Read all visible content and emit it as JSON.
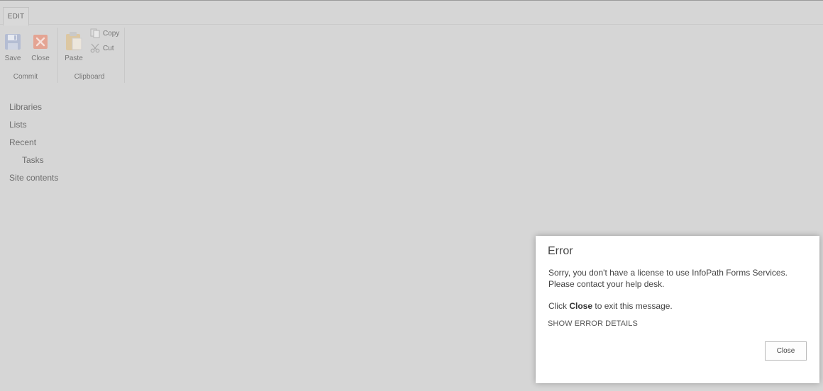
{
  "ribbon": {
    "tab_label": "EDIT",
    "commit_group": {
      "label": "Commit",
      "save_label": "Save",
      "save_icon": "floppy-disk-icon",
      "close_label": "Close",
      "close_icon": "close-x-icon"
    },
    "clipboard_group": {
      "label": "Clipboard",
      "paste_label": "Paste",
      "paste_icon": "clipboard-paste-icon",
      "copy_label": "Copy",
      "copy_icon": "copy-icon",
      "cut_label": "Cut",
      "cut_icon": "scissors-icon"
    }
  },
  "nav": {
    "items": [
      {
        "label": "Libraries"
      },
      {
        "label": "Lists"
      },
      {
        "label": "Recent"
      },
      {
        "label": "Tasks"
      },
      {
        "label": "Site contents"
      }
    ]
  },
  "dialog": {
    "title": "Error",
    "message": "Sorry, you don't have a license to use InfoPath Forms Services. Please contact your help desk.",
    "click_prefix": "Click ",
    "click_bold": "Close",
    "click_suffix": " to exit this message.",
    "details_link": "SHOW ERROR DETAILS",
    "close_button": "Close"
  },
  "colors": {
    "overlay_background": "#d6d6d6",
    "dialog_background": "#ffffff",
    "close_icon_red": "#e8a89a",
    "save_icon_blue": "#a7b2cc"
  }
}
